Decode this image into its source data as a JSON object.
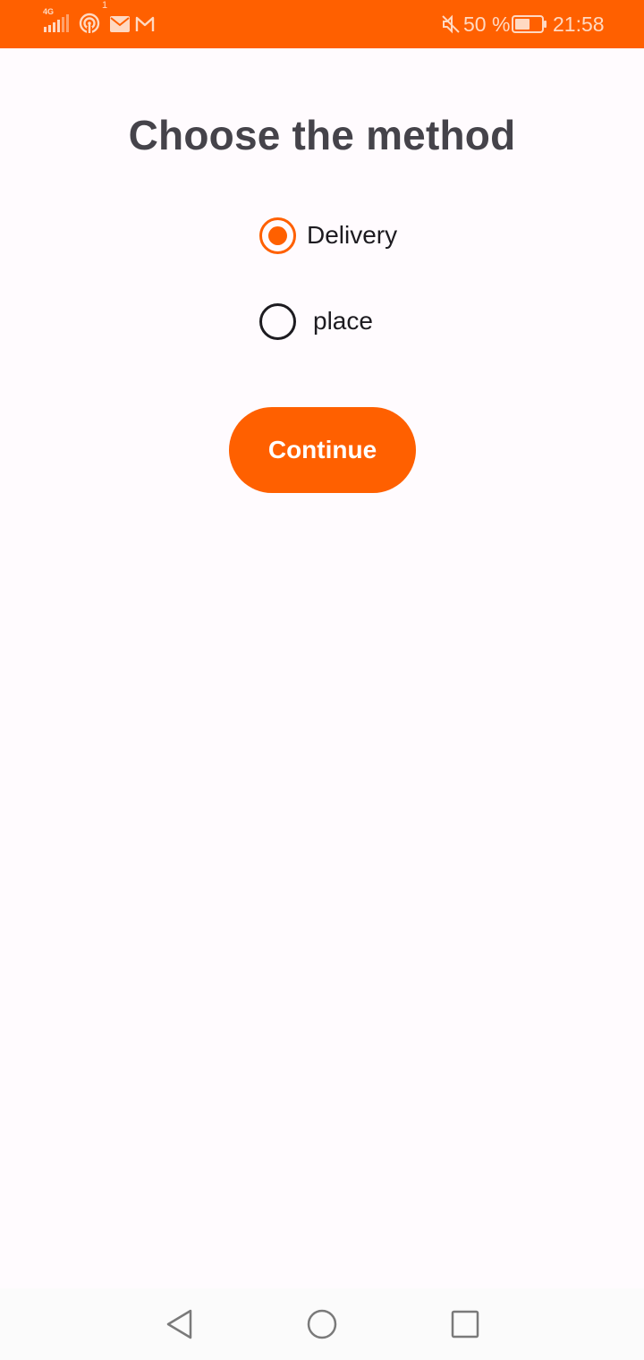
{
  "status_bar": {
    "network_type": "4G",
    "notification_count": "1",
    "battery_text": "50 %",
    "time": "21:58",
    "icons": [
      "signal-icon",
      "hotspot-icon",
      "mail-icon",
      "gmail-icon",
      "mute-icon",
      "battery-icon"
    ]
  },
  "main": {
    "title": "Choose the method",
    "options": [
      {
        "label": "Delivery",
        "checked": true
      },
      {
        "label": "place",
        "checked": false
      }
    ],
    "continue_label": "Continue"
  },
  "nav_bar": {
    "buttons": [
      "back-icon",
      "home-icon",
      "recents-icon"
    ]
  },
  "colors": {
    "accent": "#FF6000",
    "title": "#45434A",
    "text": "#1D1B20",
    "background": "#FFFBFE"
  }
}
